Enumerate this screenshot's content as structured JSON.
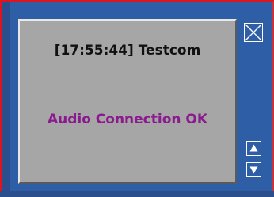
{
  "message": {
    "time_line": "[17:55:44] Testcom",
    "status_line": "Audio Connection OK"
  },
  "colors": {
    "frame_blue": "#2e5ea5",
    "frame_border_red": "#e0141c",
    "panel_gray": "#a6a6a6",
    "status_purple": "#8a1a8e"
  },
  "icons": {
    "close": "close-x-icon",
    "scroll_up": "triangle-up-icon",
    "scroll_down": "triangle-down-icon"
  }
}
